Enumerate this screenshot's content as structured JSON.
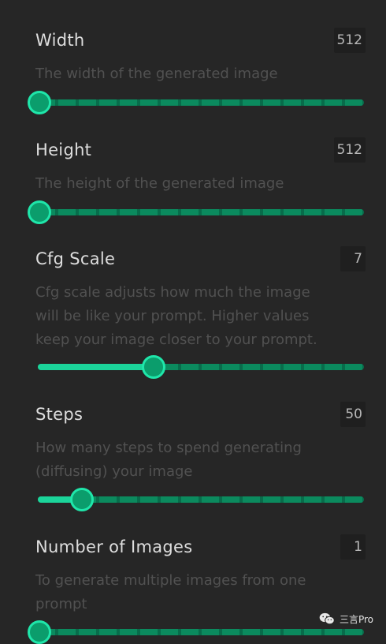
{
  "colors": {
    "background": "#262626",
    "track": "#0b8a5e",
    "fill": "#1bd49a",
    "knob_border": "#1fe6aa"
  },
  "settings": [
    {
      "title": "Width",
      "value": "512",
      "description": [
        "The width of the generated image"
      ],
      "slider_fraction": 0.0
    },
    {
      "title": "Height",
      "value": "512",
      "description": [
        "The height of the generated image"
      ],
      "slider_fraction": 0.0
    },
    {
      "title": "Cfg Scale",
      "value": "7",
      "description": [
        "Cfg scale adjusts how much the image",
        "will be like your prompt. Higher values",
        "keep your image closer to your prompt."
      ],
      "slider_fraction": 0.35
    },
    {
      "title": "Steps",
      "value": "50",
      "description": [
        "How many steps to spend generating",
        "(diffusing) your image"
      ],
      "slider_fraction": 0.13
    },
    {
      "title": "Number of Images",
      "value": "1",
      "description": [
        "To generate multiple images from one",
        "prompt"
      ],
      "slider_fraction": 0.0
    }
  ],
  "watermark": {
    "icon": "wechat-icon",
    "text": "三言Pro"
  }
}
